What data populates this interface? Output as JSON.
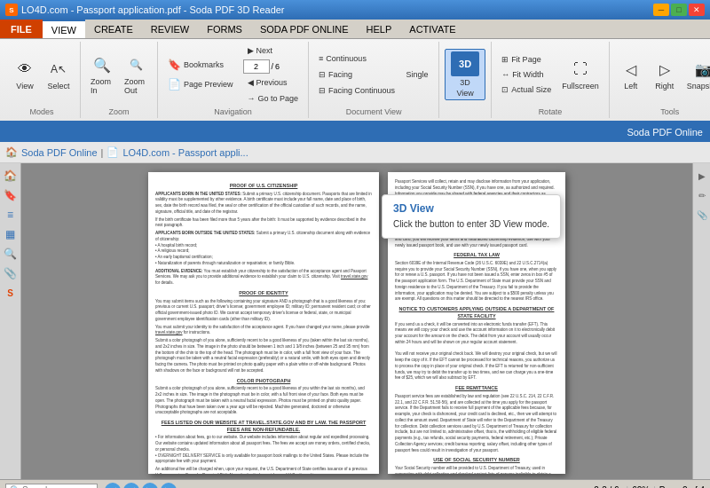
{
  "titleBar": {
    "title": "LO4D.com - Passport application.pdf - Soda PDF 3D Reader",
    "icon": "S",
    "buttons": {
      "minimize": "—",
      "maximize": "□",
      "close": "✕"
    }
  },
  "menuBar": {
    "items": [
      "FILE",
      "VIEW",
      "CREATE",
      "REVIEW",
      "FORMS",
      "SODA PDF ONLINE",
      "HELP",
      "ACTIVATE"
    ]
  },
  "ribbon": {
    "groups": [
      {
        "label": "Modes",
        "items": [
          {
            "id": "view-btn",
            "icon": "👁",
            "label": "View"
          },
          {
            "id": "select-btn",
            "icon": "↖",
            "label": "A↖ Select"
          }
        ]
      },
      {
        "label": "Zoom",
        "items": [
          {
            "id": "zoom-in-btn",
            "icon": "🔍",
            "label": "Zoom In"
          },
          {
            "id": "zoom-out-btn",
            "icon": "🔍",
            "label": "Zoom Out"
          }
        ]
      },
      {
        "label": "Navigation",
        "items": [
          {
            "id": "bookmarks-btn",
            "icon": "🔖",
            "label": "Bookmarks"
          },
          {
            "id": "page-prev-btn",
            "icon": "◀",
            "label": "Previous"
          },
          {
            "id": "next-btn",
            "icon": "▶",
            "label": "Next"
          },
          {
            "id": "page-preview-btn",
            "icon": "□",
            "label": "Page Preview"
          },
          {
            "id": "goto-btn",
            "icon": "→□",
            "label": "Go to Page"
          },
          {
            "id": "page-num",
            "value": "2",
            "separator": "/",
            "total": "6"
          }
        ]
      },
      {
        "label": "Document View",
        "items": [
          {
            "id": "single-btn",
            "label": "Single"
          },
          {
            "id": "continuous-btn",
            "icon": "≡",
            "label": "Continuous"
          },
          {
            "id": "facing-btn",
            "icon": "⊟",
            "label": "Facing"
          },
          {
            "id": "facing-cont-btn",
            "icon": "⊟⊟",
            "label": "Facing Continuous"
          }
        ]
      },
      {
        "label": "",
        "items": [
          {
            "id": "3d-view-btn",
            "icon": "3D",
            "label": "3D\nView",
            "active": true
          }
        ]
      },
      {
        "label": "Rotate",
        "items": [
          {
            "id": "fullscreen-btn",
            "icon": "⛶",
            "label": "Fullscreen"
          },
          {
            "id": "fit-page-btn",
            "label": "Fit Page"
          },
          {
            "id": "fit-width-btn",
            "label": "Fit Width"
          },
          {
            "id": "actual-size-btn",
            "label": "Actual Size"
          }
        ]
      },
      {
        "label": "Tools",
        "items": [
          {
            "id": "left-btn",
            "icon": "◀",
            "label": "Left"
          },
          {
            "id": "right-btn",
            "icon": "▶",
            "label": "Right"
          },
          {
            "id": "snapshot-btn",
            "icon": "📷",
            "label": "Snapshot"
          }
        ]
      }
    ]
  },
  "sodaBar": {
    "text": "Soda PDF Online"
  },
  "addressBar": {
    "back": "◀",
    "forward": "▶",
    "home": "🏠",
    "address": "LO4D.com - Passport appli...",
    "breadcrumb": "Soda PDF Online | LO4D.com - Passport appli..."
  },
  "tooltip": {
    "title": "3D View",
    "text": "Click the button to enter 3D View mode."
  },
  "pdfPage1": {
    "sections": [
      {
        "title": "PROOF OF U.S. CITIZENSHIP"
      },
      {
        "text": "APPLICANTS BORN IN THE UNITED STATES: Submit a primary U.S. citizenship document. Passports that are limited in validity must be supplemented by other evidence. A birth certificate must include your full name, date and place of birth, sex, date the birth record was filed, the seal or other certification of the official custodian of such records, and the name, signature, official title, and date of the registrar."
      },
      {
        "text": "If your birth certificate has been less than 5 years after the birth: It must be supported by evidence described in the next paragraph."
      },
      {
        "text": "APPLICANTS BORN OUTSIDE THE UNITED STATES: Submit a primary U.S. citizenship document along with evidence of citizenship, such as:\n• A hospital birth record;\n• A religious record;\n• A baptismal or church certification;\n• A naturalization certificate; or\n• Evidence of parents citizenship"
      },
      {
        "text": "ADDITIONAL EVIDENCE: You must establish your citizenship to the satisfaction of the acceptance agent and Passport Services. We may ask you to provide additional evidence to establish your claim to U.S. citizenship. Visit travel.state.gov for details."
      },
      {
        "title": "PROOF OF IDENTITY"
      },
      {
        "text": "You may submit items such as the following containing your signature AND a photograph that is a good likeness of you: previous or current U.S. passport; driver's license; government employee ID; military ID; permanent resident card; or other official government-issued photo ID. We cannot accept temporary driver's license or federal, state, or municipal government employee identification cards (other than military ID)."
      }
    ]
  },
  "pdfPage2": {
    "sections": [
      {
        "text": "Passport Services will collect, retain and may disclose information from your application, including your Social Security Number..."
      },
      {
        "title": "FEDERAL TAX LAW"
      },
      {
        "text": "Section 6039E of the Internal Revenue Code (26 U.S.C. 6039E) and 22 U.S.C.2714(a) require you to provide your Social Security Number (SSN), if you have one, when you apply for or renew a U.S. passport. If you have not been issued a SSN, enter zeros in box #5 of the passport application..."
      },
      {
        "title": "NOTICE TO CUSTOMERS APPLYING OUTSIDE A DEPARTMENT OF STATE FACILITY"
      },
      {
        "text": "If you send us a check, it will be converted into an electronic funds transfer (EFT). This means we will copy your check and use the account information on it to electronically debit your account for the amount on the check..."
      },
      {
        "title": "FEE REMITTANCE"
      },
      {
        "text": "Passport service fees are established by law and regulation (see 22 U.S.C. 214, 22 C.F.R. 22.1, and 22 C.F.R. 51.50-56), and are collected at the time you apply for the passport service..."
      },
      {
        "title": "USE OF SOCIAL SECURITY NUMBER"
      },
      {
        "text": "Your Social Security number will be provided to U.S. Department of Treasury, used in connection with debt collection and checked against lists of persons ineligible to obtain a passport..."
      }
    ]
  },
  "statusBar": {
    "searchPlaceholder": "Search",
    "navigation": {
      "back": "◀",
      "prev": "◀",
      "next": "▶",
      "forward": "▶"
    },
    "pageDisplay": "2-3 / 6",
    "zoom": "62%",
    "pageInfo": "Page 2 of 4"
  }
}
